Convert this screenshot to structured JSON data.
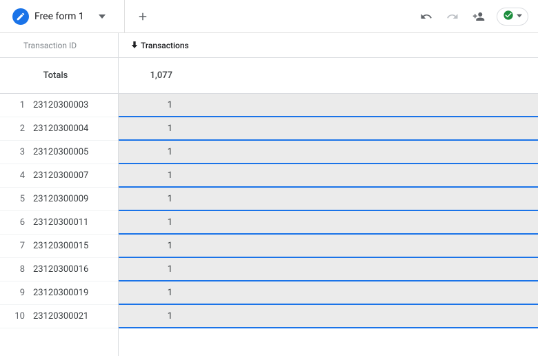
{
  "toolbar": {
    "tab_name": "Free form 1"
  },
  "headers": {
    "dimension": "Transaction ID",
    "metric": "Transactions"
  },
  "totals": {
    "label": "Totals",
    "value": "1,077"
  },
  "rows": [
    {
      "index": "1",
      "id": "23120300003",
      "value": "1"
    },
    {
      "index": "2",
      "id": "23120300004",
      "value": "1"
    },
    {
      "index": "3",
      "id": "23120300005",
      "value": "1"
    },
    {
      "index": "4",
      "id": "23120300007",
      "value": "1"
    },
    {
      "index": "5",
      "id": "23120300009",
      "value": "1"
    },
    {
      "index": "6",
      "id": "23120300011",
      "value": "1"
    },
    {
      "index": "7",
      "id": "23120300015",
      "value": "1"
    },
    {
      "index": "8",
      "id": "23120300016",
      "value": "1"
    },
    {
      "index": "9",
      "id": "23120300019",
      "value": "1"
    },
    {
      "index": "10",
      "id": "23120300021",
      "value": "1"
    }
  ]
}
